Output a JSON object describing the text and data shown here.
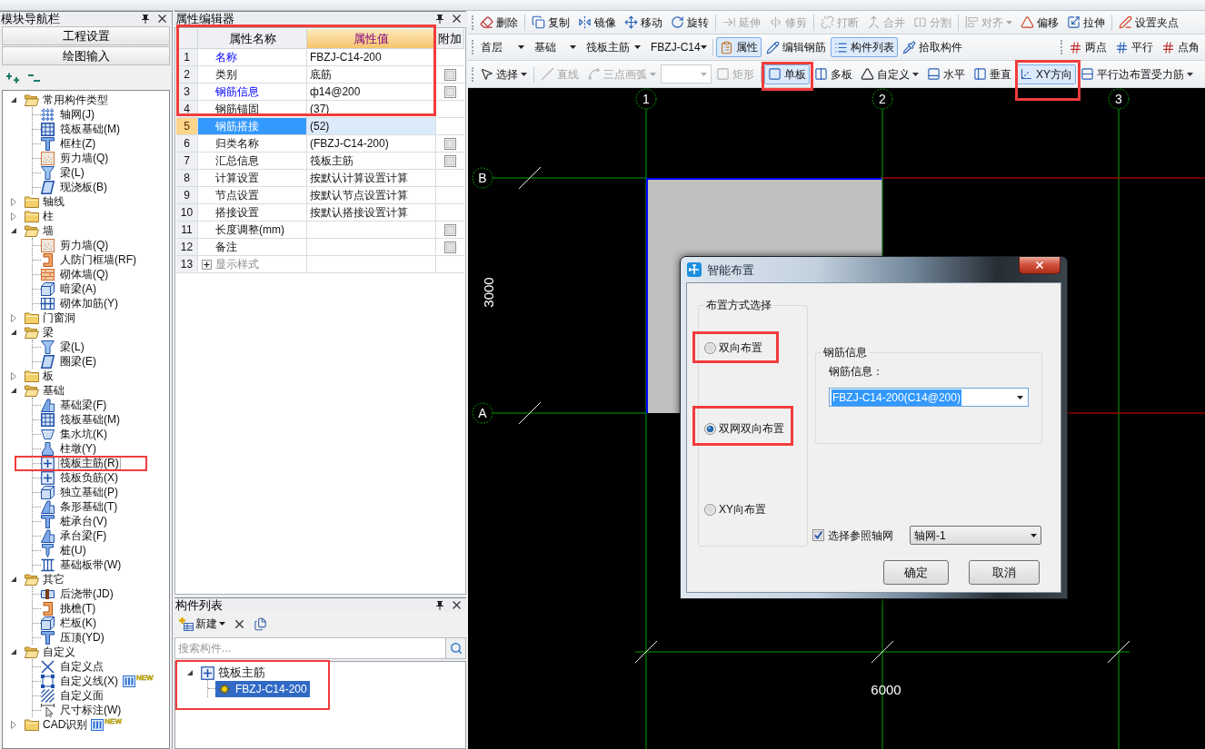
{
  "nav_panel": {
    "title": "模块导航栏",
    "buttons": [
      "工程设置",
      "绘图输入"
    ],
    "tree": [
      {
        "label": "常用构件类型",
        "expanded": true,
        "children": [
          {
            "label": "轴网(J)",
            "selected": false
          },
          {
            "label": "筏板基础(M)",
            "selected": false
          },
          {
            "label": "框柱(Z)",
            "selected": false
          },
          {
            "label": "剪力墙(Q)",
            "selected": false
          },
          {
            "label": "梁(L)",
            "selected": false
          },
          {
            "label": "现浇板(B)",
            "selected": false
          }
        ]
      },
      {
        "label": "轴线",
        "expanded": false
      },
      {
        "label": "柱",
        "expanded": false
      },
      {
        "label": "墙",
        "expanded": true,
        "children": [
          {
            "label": "剪力墙(Q)",
            "selected": false
          },
          {
            "label": "人防门框墙(RF)",
            "selected": false
          },
          {
            "label": "砌体墙(Q)",
            "selected": false
          },
          {
            "label": "暗梁(A)",
            "selected": false
          },
          {
            "label": "砌体加筋(Y)",
            "selected": false
          }
        ]
      },
      {
        "label": "门窗洞",
        "expanded": false
      },
      {
        "label": "梁",
        "expanded": true,
        "children": [
          {
            "label": "梁(L)",
            "selected": false
          },
          {
            "label": "圈梁(E)",
            "selected": false
          }
        ]
      },
      {
        "label": "板",
        "expanded": false
      },
      {
        "label": "基础",
        "expanded": true,
        "children": [
          {
            "label": "基础梁(F)",
            "selected": false
          },
          {
            "label": "筏板基础(M)",
            "selected": false
          },
          {
            "label": "集水坑(K)",
            "selected": false
          },
          {
            "label": "柱墩(Y)",
            "selected": false
          },
          {
            "label": "筏板主筋(R)",
            "selected": true
          },
          {
            "label": "筏板负筋(X)",
            "selected": false
          },
          {
            "label": "独立基础(P)",
            "selected": false
          },
          {
            "label": "条形基础(T)",
            "selected": false
          },
          {
            "label": "桩承台(V)",
            "selected": false
          },
          {
            "label": "承台梁(F)",
            "selected": false
          },
          {
            "label": "桩(U)",
            "selected": false
          },
          {
            "label": "基础板带(W)",
            "selected": false
          }
        ]
      },
      {
        "label": "其它",
        "expanded": true,
        "children": [
          {
            "label": "后浇带(JD)",
            "selected": false
          },
          {
            "label": "挑檐(T)",
            "selected": false
          },
          {
            "label": "栏板(K)",
            "selected": false
          },
          {
            "label": "压顶(YD)",
            "selected": false
          }
        ]
      },
      {
        "label": "自定义",
        "expanded": true,
        "children": [
          {
            "label": "自定义点",
            "selected": false
          },
          {
            "label": "自定义线(X)",
            "selected": false,
            "badge": "NEW"
          },
          {
            "label": "自定义面",
            "selected": false
          },
          {
            "label": "尺寸标注(W)",
            "selected": false
          }
        ]
      },
      {
        "label": "CAD识别",
        "expanded": false,
        "badge": "NEW"
      }
    ]
  },
  "property_editor": {
    "title": "属性编辑器",
    "columns": [
      {
        "label": "属性名称",
        "highlighted": false
      },
      {
        "label": "属性值",
        "highlighted": true
      },
      {
        "label": "附加",
        "highlighted": false
      }
    ],
    "rows": [
      {
        "index": "1",
        "name": "名称",
        "value": "FBZJ-C14-200",
        "kind": "common",
        "selected": false
      },
      {
        "index": "2",
        "name": "类别",
        "value": "底筋",
        "kind": "normal",
        "selected": false,
        "extra_checked": false
      },
      {
        "index": "3",
        "name": "钢筋信息",
        "value": "ф14@200",
        "kind": "common",
        "selected": false,
        "extra_checked": false
      },
      {
        "index": "4",
        "name": "钢筋锚固",
        "value": "(37)",
        "kind": "normal",
        "selected": false
      },
      {
        "index": "5",
        "name": "钢筋搭接",
        "value": "(52)",
        "kind": "normal",
        "selected": true
      },
      {
        "index": "6",
        "name": "归类名称",
        "value": "(FBZJ-C14-200)",
        "kind": "normal",
        "selected": false,
        "extra_checked": false
      },
      {
        "index": "7",
        "name": "汇总信息",
        "value": "筏板主筋",
        "kind": "normal",
        "selected": false,
        "extra_checked": false
      },
      {
        "index": "8",
        "name": "计算设置",
        "value": "按默认计算设置计算",
        "kind": "normal",
        "selected": false
      },
      {
        "index": "9",
        "name": "节点设置",
        "value": "按默认节点设置计算",
        "kind": "normal",
        "selected": false
      },
      {
        "index": "10",
        "name": "搭接设置",
        "value": "按默认搭接设置计算",
        "kind": "normal",
        "selected": false
      },
      {
        "index": "11",
        "name": "长度调整(mm)",
        "kind": "normal",
        "selected": false,
        "extra_checked": false
      },
      {
        "index": "12",
        "name": "备注",
        "kind": "normal",
        "selected": false,
        "extra_checked": false
      },
      {
        "index": "13",
        "name": "显示样式",
        "kind": "group",
        "selected": false,
        "expanded": false
      }
    ]
  },
  "component_list": {
    "title": "构件列表",
    "new_button": "新建",
    "search_placeholder": "搜索构件...",
    "tree": [
      {
        "label": "筏板主筋",
        "expanded": true,
        "children": [
          {
            "label": "FBZJ-C14-200",
            "selected": true
          }
        ]
      }
    ]
  },
  "toolbar_rows": [
    {
      "groups": [
        [
          {
            "kind": "button",
            "label": "删除",
            "disabled": false,
            "on": false,
            "dropdown": false
          }
        ],
        [
          {
            "kind": "button",
            "label": "复制",
            "disabled": false,
            "on": false,
            "dropdown": false
          },
          {
            "kind": "button",
            "label": "镜像",
            "disabled": false,
            "on": false,
            "dropdown": false
          },
          {
            "kind": "button",
            "label": "移动",
            "disabled": false,
            "on": false,
            "dropdown": false
          },
          {
            "kind": "button",
            "label": "旋转",
            "disabled": false,
            "on": false,
            "dropdown": false
          }
        ],
        [
          {
            "kind": "button",
            "label": "延伸",
            "disabled": true,
            "on": false,
            "dropdown": false
          },
          {
            "kind": "button",
            "label": "修剪",
            "disabled": true,
            "on": false,
            "dropdown": false
          }
        ],
        [
          {
            "kind": "button",
            "label": "打断",
            "disabled": true,
            "on": false,
            "dropdown": false
          },
          {
            "kind": "button",
            "label": "合并",
            "disabled": true,
            "on": false,
            "dropdown": false
          },
          {
            "kind": "button",
            "label": "分割",
            "disabled": true,
            "on": false,
            "dropdown": false
          }
        ],
        [
          {
            "kind": "button",
            "label": "对齐",
            "disabled": true,
            "on": false,
            "dropdown": true
          },
          {
            "kind": "button",
            "label": "偏移",
            "disabled": false,
            "on": false,
            "dropdown": false
          },
          {
            "kind": "button",
            "label": "拉伸",
            "disabled": false,
            "on": false,
            "dropdown": false
          }
        ],
        [
          {
            "kind": "button",
            "label": "设置夹点",
            "disabled": false,
            "on": false,
            "dropdown": false
          }
        ]
      ]
    },
    {
      "groups": [
        [
          {
            "kind": "combo",
            "value": "首层",
            "disabled": false
          },
          {
            "kind": "combo",
            "value": "基础",
            "disabled": false
          },
          {
            "kind": "combo",
            "value": "筏板主筋",
            "disabled": false
          },
          {
            "kind": "combo",
            "value": "FBZJ-C14",
            "disabled": false
          }
        ],
        [
          {
            "kind": "button",
            "label": "属性",
            "disabled": false,
            "on": true,
            "dropdown": false
          },
          {
            "kind": "button",
            "label": "编辑钢筋",
            "disabled": false,
            "on": false,
            "dropdown": false
          },
          {
            "kind": "button",
            "label": "构件列表",
            "disabled": false,
            "on": true,
            "dropdown": false
          },
          {
            "kind": "button",
            "label": "拾取构件",
            "disabled": false,
            "on": false,
            "dropdown": false
          }
        ]
      ],
      "trailing": [
        {
          "kind": "button",
          "label": "两点",
          "disabled": false,
          "on": false,
          "dropdown": false
        },
        {
          "kind": "button",
          "label": "平行",
          "disabled": false,
          "on": false,
          "dropdown": false
        },
        {
          "kind": "button",
          "label": "点角",
          "disabled": false,
          "on": false,
          "dropdown": false
        }
      ]
    },
    {
      "groups": [
        [
          {
            "kind": "button",
            "label": "选择",
            "disabled": false,
            "on": false,
            "dropdown": true
          }
        ],
        [
          {
            "kind": "button",
            "label": "直线",
            "disabled": true,
            "on": false,
            "dropdown": false
          },
          {
            "kind": "button",
            "label": "三点画弧",
            "disabled": true,
            "on": false,
            "dropdown": true
          },
          {
            "kind": "combo",
            "disabled": true
          },
          {
            "kind": "button",
            "label": "矩形",
            "disabled": true,
            "on": false,
            "dropdown": false
          }
        ],
        [
          {
            "kind": "button",
            "label": "单板",
            "disabled": false,
            "on": true,
            "dropdown": false
          },
          {
            "kind": "button",
            "label": "多板",
            "disabled": false,
            "on": false,
            "dropdown": false
          },
          {
            "kind": "button",
            "label": "自定义",
            "disabled": false,
            "on": false,
            "dropdown": true
          },
          {
            "kind": "button",
            "label": "水平",
            "disabled": false,
            "on": false,
            "dropdown": false
          },
          {
            "kind": "button",
            "label": "垂直",
            "disabled": false,
            "on": false,
            "dropdown": false
          },
          {
            "kind": "button",
            "label": "XY方向",
            "disabled": false,
            "on": true,
            "dropdown": false
          },
          {
            "kind": "button",
            "label": "平行边布置受力筋",
            "disabled": false,
            "on": false,
            "dropdown": true
          }
        ]
      ]
    }
  ],
  "canvas": {
    "column_axes": [
      "1",
      "2",
      "3"
    ],
    "row_axes": [
      "B",
      "A"
    ],
    "height_dimension": "3000",
    "width_dimension": "6000"
  },
  "dialog": {
    "title": "智能布置",
    "mode_group": "布置方式选择",
    "modes": [
      {
        "label": "双向布置",
        "selected": false
      },
      {
        "label": "双网双向布置",
        "selected": true
      },
      {
        "label": "XY向布置",
        "selected": false
      }
    ],
    "rebar_group": "钢筋信息",
    "rebar_label": "钢筋信息：",
    "rebar_select": {
      "value": "FBZJ-C14-200(C14@200)",
      "focused": true
    },
    "axis_checkbox": {
      "label": "选择参照轴网",
      "checked": true
    },
    "axis_select": "轴网-1",
    "buttons": [
      "确定",
      "取消"
    ]
  }
}
